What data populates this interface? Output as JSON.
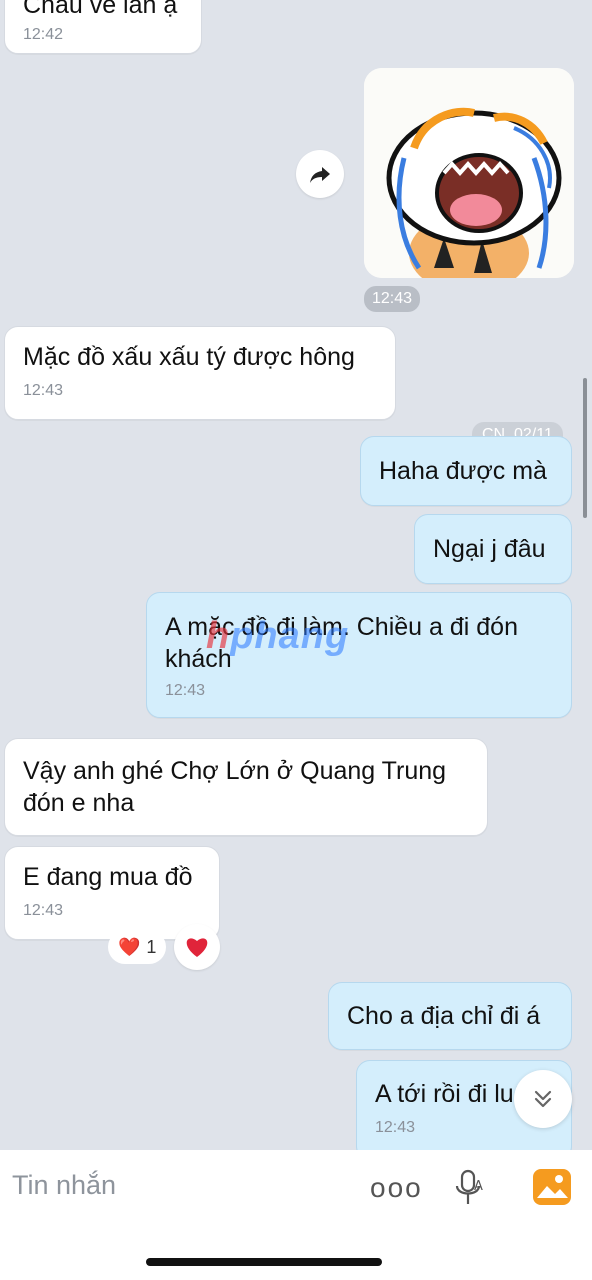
{
  "messages": {
    "m0": {
      "text": "Cháu về lấn ạ",
      "time": "12:42"
    },
    "sticker_time": "12:43",
    "m1": {
      "text": "Mặc đồ xấu xấu tý được hông",
      "time": "12:43"
    },
    "date_tag": "CN, 02/11",
    "m2": {
      "text": "Haha được mà"
    },
    "m3": {
      "text": "Ngại j đâu"
    },
    "m4": {
      "text": "A mặc đồ đi làm. Chiều a đi đón khách",
      "time": "12:43"
    },
    "m5": {
      "text": "Vậy anh ghé Chợ Lớn ở Quang Trung đón e nha"
    },
    "m6": {
      "text": "E đang mua đồ",
      "time": "12:43"
    },
    "m7": {
      "text": "Cho a địa chỉ đi á"
    },
    "m8": {
      "text": "A tới rồi đi luôn",
      "time": "12:43"
    }
  },
  "reaction": {
    "emoji": "❤️",
    "count": "1"
  },
  "watermark": {
    "first": "h",
    "rest": "phang"
  },
  "composer": {
    "placeholder": "Tin nhắn",
    "more": "ooo"
  },
  "colors": {
    "background": "#dfe3ea",
    "incoming": "#ffffff",
    "outgoing": "#d4eefc",
    "accent": "#f59b1f"
  },
  "icons": [
    "share-icon",
    "heart-icon",
    "chevron-down-double-icon",
    "mic-icon",
    "photo-icon"
  ]
}
